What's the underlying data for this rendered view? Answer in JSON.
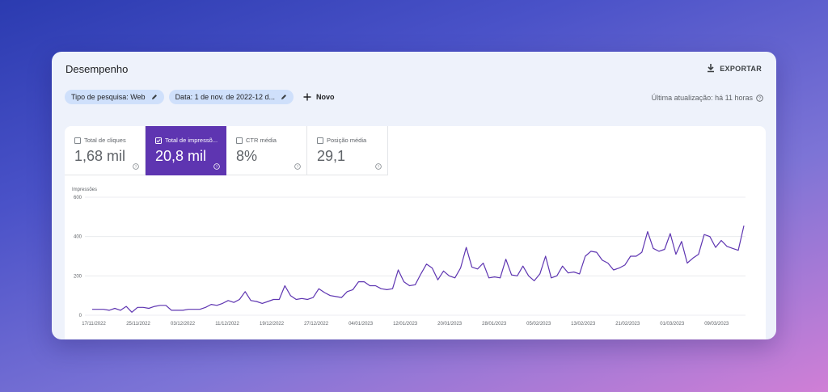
{
  "page": {
    "title": "Desempenho",
    "export_label": "EXPORTAR",
    "last_update": "Última atualização: há 11 horas"
  },
  "filters": {
    "search_type": "Tipo de pesquisa: Web",
    "date": "Data: 1 de nov. de 2022-12 d...",
    "new_label": "Novo"
  },
  "metrics": [
    {
      "label": "Total de cliques",
      "value": "1,68 mil",
      "selected": false
    },
    {
      "label": "Total de impressõ...",
      "value": "20,8 mil",
      "selected": true
    },
    {
      "label": "CTR média",
      "value": "8%",
      "selected": false
    },
    {
      "label": "Posição média",
      "value": "29,1",
      "selected": false
    }
  ],
  "colors": {
    "accent": "#5e35b1",
    "line": "#5e35b1",
    "chip_bg": "#cfe0fb"
  },
  "chart_data": {
    "type": "line",
    "ylabel": "Impressões",
    "ylim": [
      0,
      600
    ],
    "yticks": [
      0,
      200,
      400,
      600
    ],
    "grid": true,
    "x_ticks": [
      "17/11/2022",
      "25/11/2022",
      "03/12/2022",
      "11/12/2022",
      "19/12/2022",
      "27/12/2022",
      "04/01/2023",
      "12/01/2023",
      "20/01/2023",
      "28/01/2023",
      "05/02/2023",
      "13/02/2023",
      "21/02/2023",
      "01/03/2023",
      "09/03/2023"
    ],
    "series": [
      {
        "values": [
          30,
          30,
          30,
          25,
          35,
          25,
          45,
          15,
          40,
          40,
          35,
          45,
          50,
          50,
          25,
          25,
          25,
          30,
          30,
          30,
          40,
          55,
          50,
          60,
          75,
          65,
          80,
          120,
          75,
          70,
          60,
          70,
          80,
          80,
          150,
          100,
          80,
          85,
          80,
          90,
          135,
          115,
          100,
          95,
          90,
          120,
          130,
          170,
          170,
          150,
          150,
          135,
          130,
          135,
          230,
          170,
          150,
          155,
          210,
          260,
          240,
          180,
          225,
          200,
          190,
          240,
          345,
          245,
          235,
          265,
          190,
          195,
          190,
          285,
          205,
          200,
          250,
          200,
          175,
          210,
          300,
          190,
          200,
          250,
          215,
          220,
          210,
          300,
          325,
          320,
          280,
          265,
          230,
          240,
          255,
          300,
          300,
          320,
          425,
          340,
          325,
          335,
          415,
          310,
          375,
          265,
          290,
          310,
          410,
          400,
          345,
          380,
          350,
          340,
          330,
          455
        ]
      }
    ]
  }
}
